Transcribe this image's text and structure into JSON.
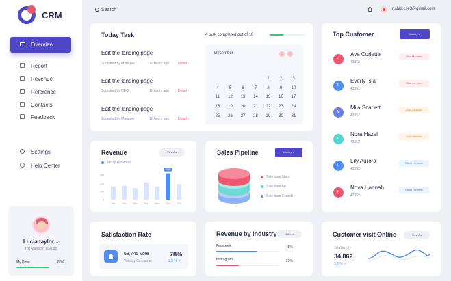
{
  "app": {
    "name": "CRM"
  },
  "sidebar": {
    "active": "Overview",
    "items": [
      "Report",
      "Revenue",
      "Reference",
      "Contacts",
      "Feedback"
    ],
    "bottom": [
      "Settings",
      "Help Center"
    ]
  },
  "profile": {
    "name": "Lucia taylor",
    "role": "HR Manager at Atlas",
    "drive_label": "My Drive",
    "drive_value": "80%",
    "drive_fill": 0.8
  },
  "topbar": {
    "search": "Search",
    "email": "nahid.cse3@gmail.com"
  },
  "today_task": {
    "title": "Today Task",
    "summary": "4 task completed out of 10",
    "progress": 0.4,
    "tasks": [
      {
        "title": "Edit the landing page",
        "by": "Submited by Manager",
        "time": "12 hours ago",
        "action": "Detail"
      },
      {
        "title": "Edit the landing page",
        "by": "Submited by CEO",
        "time": "11 hours ago",
        "action": "Detail"
      },
      {
        "title": "Edit the landing page",
        "by": "Submited by Manager",
        "time": "10 hours ago",
        "action": "Detail"
      }
    ]
  },
  "calendar": {
    "month": "December",
    "rows": [
      [
        "",
        "",
        "",
        "",
        "1",
        "2",
        "3"
      ],
      [
        "4",
        "5",
        "6",
        "7",
        "8",
        "9",
        "10"
      ],
      [
        "11",
        "12",
        "13",
        "14",
        "15",
        "16",
        "17"
      ],
      [
        "18",
        "19",
        "20",
        "21",
        "22",
        "23",
        "24"
      ],
      [
        "25",
        "26",
        "27",
        "28",
        "29",
        "30",
        "31"
      ]
    ]
  },
  "top_customer": {
    "title": "Top Customer",
    "filter": "Weekly",
    "customers": [
      {
        "name": "Ava Corlette",
        "id": "43352",
        "tier": "Star Member",
        "color": "#f0566f",
        "initial": "A",
        "tier_bg": "#fdeef0",
        "tier_fg": "#e0566f"
      },
      {
        "name": "Everly Isla",
        "id": "43352",
        "tier": "Star member",
        "color": "#4f8ef0",
        "initial": "E",
        "tier_bg": "#fdeef0",
        "tier_fg": "#e0566f"
      },
      {
        "name": "Mila Scarlett",
        "id": "43352",
        "tier": "Gold Member",
        "color": "#6a7ee8",
        "initial": "M",
        "tier_bg": "#fff4e6",
        "tier_fg": "#d08a2a"
      },
      {
        "name": "Nora Hazel",
        "id": "43352",
        "tier": "Gold Member",
        "color": "#4fd6d0",
        "initial": "N",
        "tier_bg": "#fff4e6",
        "tier_fg": "#d08a2a"
      },
      {
        "name": "Lily Aurora",
        "id": "43352",
        "tier": "Silver Member",
        "color": "#4f8ef0",
        "initial": "L",
        "tier_bg": "#eaf3ff",
        "tier_fg": "#4f7ad0"
      },
      {
        "name": "Nova Hannah",
        "id": "43352",
        "tier": "Silver Member",
        "color": "#f0566f",
        "initial": "N",
        "tier_bg": "#eaf3ff",
        "tier_fg": "#4f7ad0"
      }
    ]
  },
  "revenue": {
    "title": "Revenue",
    "button": "View As",
    "legend": "Today Revenue",
    "highlight": "$450"
  },
  "sales_pipeline": {
    "title": "Sales Pipeline",
    "filter": "Weekly",
    "legend": [
      {
        "label": "Sale from Store",
        "color": "#f0566f"
      },
      {
        "label": "Sale from Ad",
        "color": "#4fd6d0"
      },
      {
        "label": "Sale from Search",
        "color": "#4f8ef0"
      }
    ]
  },
  "satisfaction": {
    "title": "Satisfaction Rate",
    "votes": "63,745 vote",
    "by": "Vote by Consumer",
    "rate": "78%",
    "change": "2.3 %"
  },
  "industry": {
    "title": "Revenue by Industry",
    "button": "View As",
    "rows": [
      {
        "label": "Facebook",
        "value": "45%",
        "fill": 0.45,
        "color": "#4f8ef0"
      },
      {
        "label": "Instragram",
        "value": "25%",
        "fill": 0.25,
        "color": "#f0566f"
      }
    ]
  },
  "visits": {
    "title": "Customer visit Online",
    "button": "View As",
    "label": "Total in july",
    "value": "34,862",
    "change": "3.6 %"
  },
  "chart_data": {
    "type": "bar",
    "categories": [
      "Sat",
      "Sun",
      "Mon",
      "Tue",
      "Wed",
      "Thu",
      "Fri"
    ],
    "values": [
      160,
      170,
      140,
      210,
      160,
      320,
      190
    ],
    "ylim": [
      0,
      300
    ],
    "yticks": [
      "0",
      "100",
      "200",
      "300"
    ],
    "highlight_index": 5,
    "colors": {
      "bar": "#d7e4fb",
      "highlight": "#4f8ef0"
    }
  }
}
